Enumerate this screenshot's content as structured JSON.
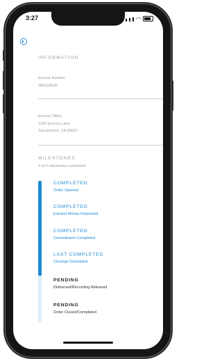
{
  "status_bar": {
    "time": "3:27"
  },
  "information": {
    "title": "INFORMATION",
    "escrow_number_label": "Escrow Number",
    "escrow_number_value": "080322NJF",
    "escrow_office_label": "Escrow Office",
    "escrow_office_address1": "1000 Escrow Lane",
    "escrow_office_address2": "Sacramento, CA 95822"
  },
  "milestones": {
    "title": "MILESTONES",
    "summary": "4 of 6 milestones completed",
    "completed_fraction": 0.667,
    "items": [
      {
        "status": "COMPLETED",
        "name": "Order Opened"
      },
      {
        "status": "COMPLETED",
        "name": "Earnest Money Deposited"
      },
      {
        "status": "COMPLETED",
        "name": "Commitment Completed"
      },
      {
        "status": "LAST COMPLETED",
        "name": "Closings Scheduled"
      },
      {
        "status": "PENDING",
        "name": "Disbursed/Recording Released"
      },
      {
        "status": "PENDING",
        "name": "Order Closed/Completed"
      }
    ]
  },
  "colors": {
    "accent": "#1f8ad2",
    "track": "#dbeef9"
  },
  "icons": {
    "back": "back-circle-icon"
  }
}
